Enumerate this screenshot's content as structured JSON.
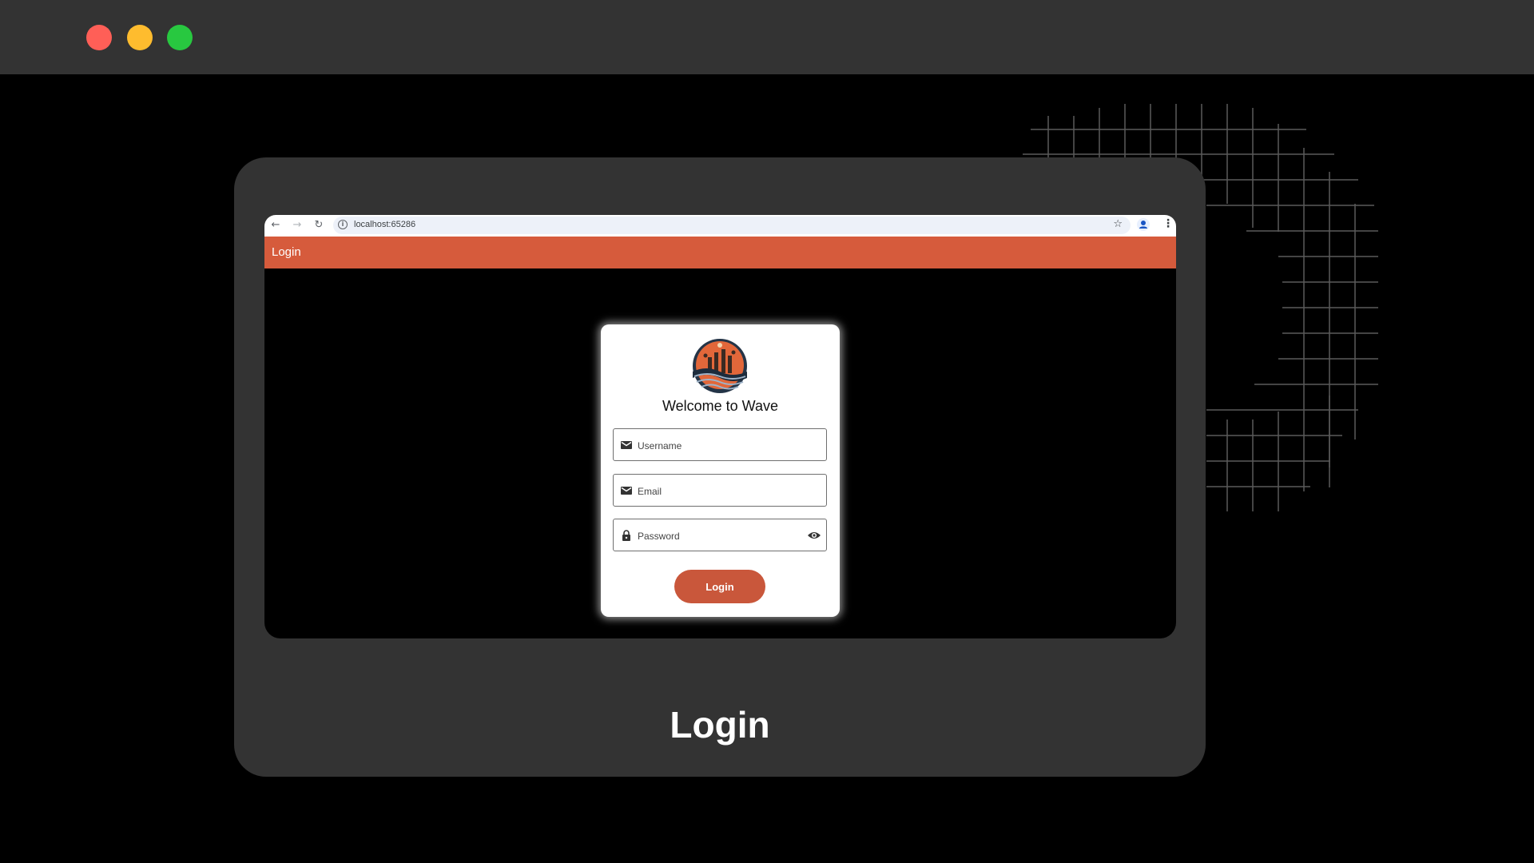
{
  "window": {
    "controls": [
      "close",
      "minimize",
      "maximize"
    ]
  },
  "browser": {
    "url": "localhost:65286",
    "icons": [
      "back-arrow-icon",
      "forward-arrow-icon",
      "reload-icon",
      "site-info-icon",
      "bookmark-star-icon",
      "profile-icon",
      "menu-icon"
    ]
  },
  "appbar": {
    "title": "Login"
  },
  "login_card": {
    "welcome": "Welcome to Wave",
    "username_label": "Username",
    "email_label": "Email",
    "password_label": "Password",
    "login_button": "Login"
  },
  "caption": "Login",
  "colors": {
    "accent": "#d65b3c",
    "button": "#c9573b",
    "frame": "#333333",
    "background": "#000000"
  }
}
